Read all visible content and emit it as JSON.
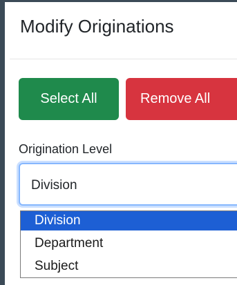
{
  "modal": {
    "title": "Modify Originations"
  },
  "actions": {
    "select_all_label": "Select All",
    "remove_all_label": "Remove All",
    "select_all_color": "#1f8a4c",
    "remove_all_color": "#d7343f"
  },
  "origination_level": {
    "label": "Origination Level",
    "selected_value": "Division",
    "options": [
      {
        "label": "Division",
        "selected": true
      },
      {
        "label": "Department",
        "selected": false
      },
      {
        "label": "Subject",
        "selected": false
      }
    ],
    "highlight_color": "#1d5fd4"
  }
}
